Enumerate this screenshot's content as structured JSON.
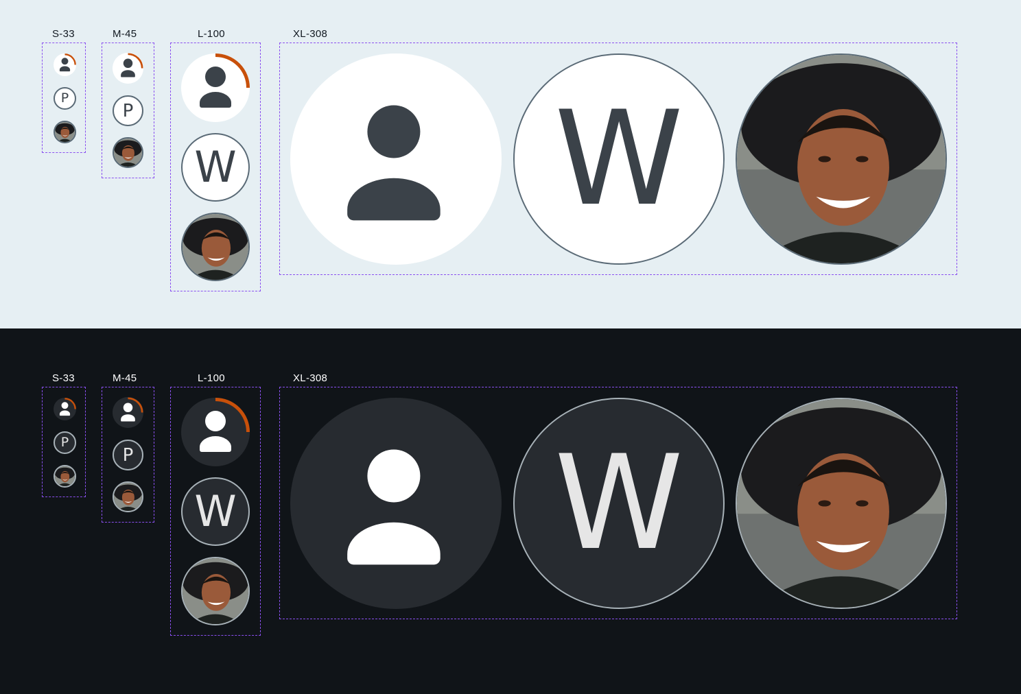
{
  "sizes": {
    "small": "S-33",
    "medium": "M-45",
    "large": "L-100",
    "xlarge": "XL-308"
  },
  "initials": {
    "small": "P",
    "medium": "P",
    "large": "W",
    "xlarge": "W"
  },
  "themes": [
    "light",
    "dark"
  ],
  "progress": 0.25,
  "colors": {
    "light_background": "#e6eff3",
    "dark_background": "#101418",
    "group_outline": "#8a4ff0",
    "progress_ring": "#c8500a",
    "light_icon_fill": "#3b4249",
    "dark_icon_fill": "#ffffff",
    "light_avatar_bg": "#ffffff",
    "dark_avatar_bg": "#272b30",
    "light_avatar_border": "#5a6a76",
    "dark_avatar_border": "#a8b2b8"
  },
  "icons": {
    "icon_avatar": "person-icon",
    "photo_avatar": "user-photo"
  }
}
